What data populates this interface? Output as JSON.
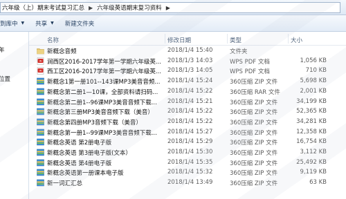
{
  "address": {
    "crumbs": [
      "六年级（上）期末考试复习汇总",
      "六年级英语期末复习资料"
    ]
  },
  "toolbar": {
    "add_to_library": "到库中",
    "share": "共享",
    "new_folder": "新建文件夹"
  },
  "nav": {
    "items": [
      "年",
      "位置"
    ]
  },
  "columns": {
    "name": "名称",
    "date": "修改日期",
    "type": "类型",
    "size": "大小"
  },
  "files": [
    {
      "name": "新概念音频",
      "date": "2018/1/4 15:40",
      "type": "文件夹",
      "size": "",
      "icon": "folder-icon"
    },
    {
      "name": "涧西区2016-2017学年第一学期六年级英...",
      "date": "2018/1/3 14:03",
      "type": "WPS PDF 文档",
      "size": "1,056 KB",
      "icon": "pdf-icon"
    },
    {
      "name": "西工区2016-2017学年第一学期六年级英...",
      "date": "2018/1/3 14:05",
      "type": "WPS PDF 文档",
      "size": "710 KB",
      "icon": "pdf-icon"
    },
    {
      "name": "新概念1第一册101--143课MP3美音音频...",
      "date": "2018/1/4 15:24",
      "type": "360压缩 ZIP 文件",
      "size": "5,698 KB",
      "icon": "zip-icon"
    },
    {
      "name": "新概念第二册1—10课，全部资料请扫码...",
      "date": "2018/1/4 15:22",
      "type": "360压缩 RAR 文件",
      "size": "2,001 KB",
      "icon": "zip-icon"
    },
    {
      "name": "新概念第二册1--96课MP3美音音频下载...",
      "date": "2018/1/4 15:21",
      "type": "360压缩 ZIP 文件",
      "size": "34,199 KB",
      "icon": "zip-icon"
    },
    {
      "name": "新概念第三册MP3美音音频下载（美音）",
      "date": "2018/1/4 15:22",
      "type": "360压缩 ZIP 文件",
      "size": "52,365 KB",
      "icon": "zip-icon"
    },
    {
      "name": "新概念第四册MP3音频下载（美音）",
      "date": "2018/1/4 15:22",
      "type": "360压缩 ZIP 文件",
      "size": "34,281 KB",
      "icon": "zip-icon"
    },
    {
      "name": "新概念第一册1--99课MP3美音音频下载...",
      "date": "2018/1/4 15:27",
      "type": "360压缩 ZIP 文件",
      "size": "12,358 KB",
      "icon": "zip-icon"
    },
    {
      "name": "新概念英语 第2册电子版",
      "date": "2018/1/4 15:29",
      "type": "360压缩 ZIP 文件",
      "size": "16,754 KB",
      "icon": "zip-icon"
    },
    {
      "name": "新概念英语 第3册电子版(文本）",
      "date": "2018/1/4 15:30",
      "type": "360压缩 ZIP 文件",
      "size": "3,112 KB",
      "icon": "zip-icon"
    },
    {
      "name": "新概念英语 第4册电子版",
      "date": "2018/1/4 15:35",
      "type": "360压缩 ZIP 文件",
      "size": "25,492 KB",
      "icon": "zip-icon"
    },
    {
      "name": "新概念英语第一册课本电子版",
      "date": "2018/1/4 15:32",
      "type": "360压缩 ZIP 文件",
      "size": "9,119 KB",
      "icon": "zip-icon"
    },
    {
      "name": "新一词汇汇总",
      "date": "2018/1/4 13:49",
      "type": "360压缩 ZIP 文件",
      "size": "63 KB",
      "icon": "zip-icon"
    }
  ]
}
